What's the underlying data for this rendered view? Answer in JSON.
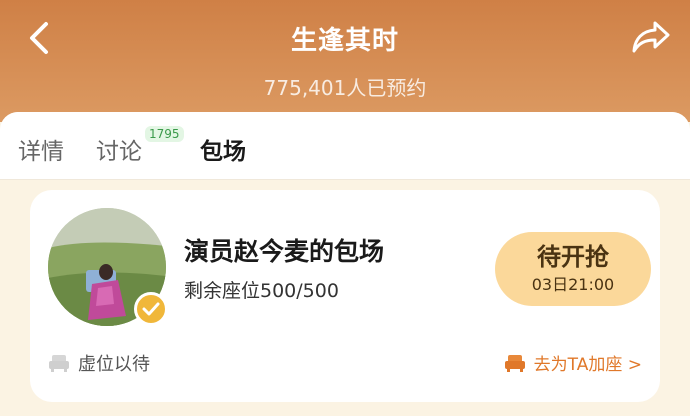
{
  "header": {
    "title": "生逢其时",
    "reservations": "775,401人已预约",
    "back_icon": "chevron-left-icon",
    "share_icon": "share-arrow-icon"
  },
  "tabs": [
    {
      "label": "详情",
      "active": false
    },
    {
      "label": "讨论",
      "active": false,
      "badge": "1795"
    },
    {
      "label": "包场",
      "active": true
    }
  ],
  "card": {
    "title": "演员赵今麦的包场",
    "seats": "剩余座位500/500",
    "status": "待开抢",
    "time": "03日21:00",
    "virtual_text": "虚位以待",
    "join_text": "去为TA加座 >",
    "verified": true
  },
  "colors": {
    "header_top": "#cf8046",
    "header_bottom": "#dc9a62",
    "status_bg": "#fbd89a",
    "link": "#e0782a",
    "badge_text": "#3a9a4a",
    "verified": "#f0b73a"
  }
}
